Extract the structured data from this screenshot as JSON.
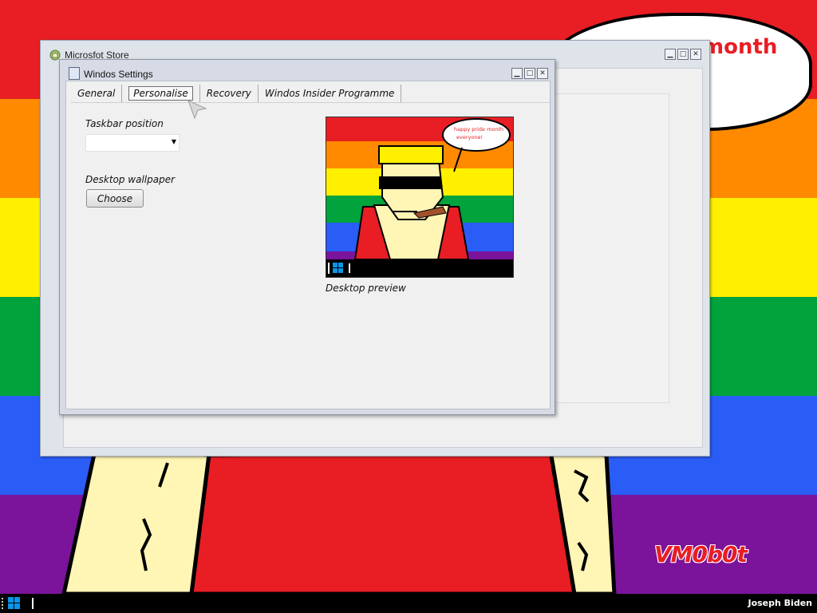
{
  "desktop": {
    "stripe_colors": [
      "#e81e24",
      "#ff8a00",
      "#fff000",
      "#00a33c",
      "#2a5cf6",
      "#7b139b"
    ],
    "bubble_text": "month",
    "watermark": "VM0b0t"
  },
  "store_window": {
    "title": "Microsfot Store",
    "icon": "store-app-icon"
  },
  "settings_window": {
    "title": "Windos Settings",
    "icon": "settings-app-icon",
    "tabs": [
      {
        "label": "General",
        "active": false
      },
      {
        "label": "Personalise",
        "active": true
      },
      {
        "label": "Recovery",
        "active": false
      },
      {
        "label": "Windos Insider Programme",
        "active": false
      }
    ],
    "taskbar_position": {
      "label": "Taskbar position",
      "value": ""
    },
    "desktop_wallpaper": {
      "label": "Desktop wallpaper",
      "button_label": "Choose"
    },
    "preview": {
      "caption": "Desktop preview",
      "speech_text_line1": "happy pride month",
      "speech_text_line2": "everyone!"
    }
  },
  "taskbar": {
    "start_icon": "windows-logo-icon",
    "user_name": "Joseph Biden"
  }
}
